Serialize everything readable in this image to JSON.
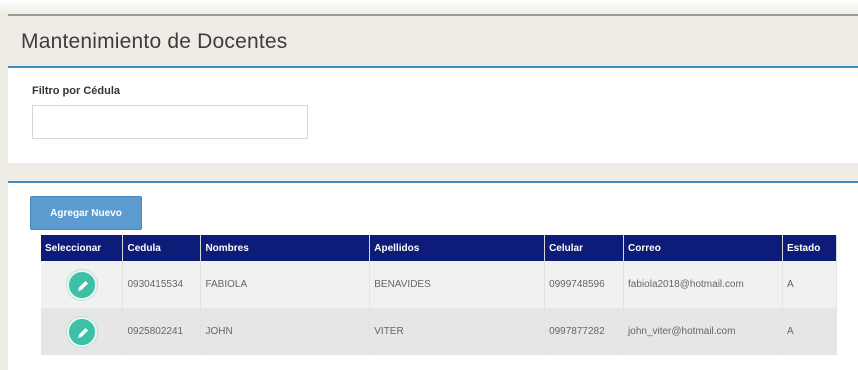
{
  "page": {
    "title": "Mantenimiento de Docentes"
  },
  "filter": {
    "label": "Filtro por Cédula",
    "value": "",
    "placeholder": ""
  },
  "actions": {
    "add_label": "Agregar Nuevo"
  },
  "table": {
    "columns": [
      "Seleccionar",
      "Cedula",
      "Nombres",
      "Apellidos",
      "Celular",
      "Correo",
      "Estado"
    ],
    "rows": [
      {
        "cedula": "0930415534",
        "nombres": "FABIOLA",
        "apellidos": "BENAVIDES",
        "celular": "0999748596",
        "correo": "fabiola2018@hotmail.com",
        "estado": "A"
      },
      {
        "cedula": "0925802241",
        "nombres": "JOHN",
        "apellidos": "VITER",
        "celular": "0997877282",
        "correo": "john_viter@hotmail.com",
        "estado": "A"
      }
    ]
  },
  "icons": {
    "edit": "pencil-icon"
  },
  "colors": {
    "header_bg": "#0c1c78",
    "accent_border": "#3c8dbc",
    "add_button": "#5b9bd0",
    "edit_button": "#3dbfa8"
  }
}
